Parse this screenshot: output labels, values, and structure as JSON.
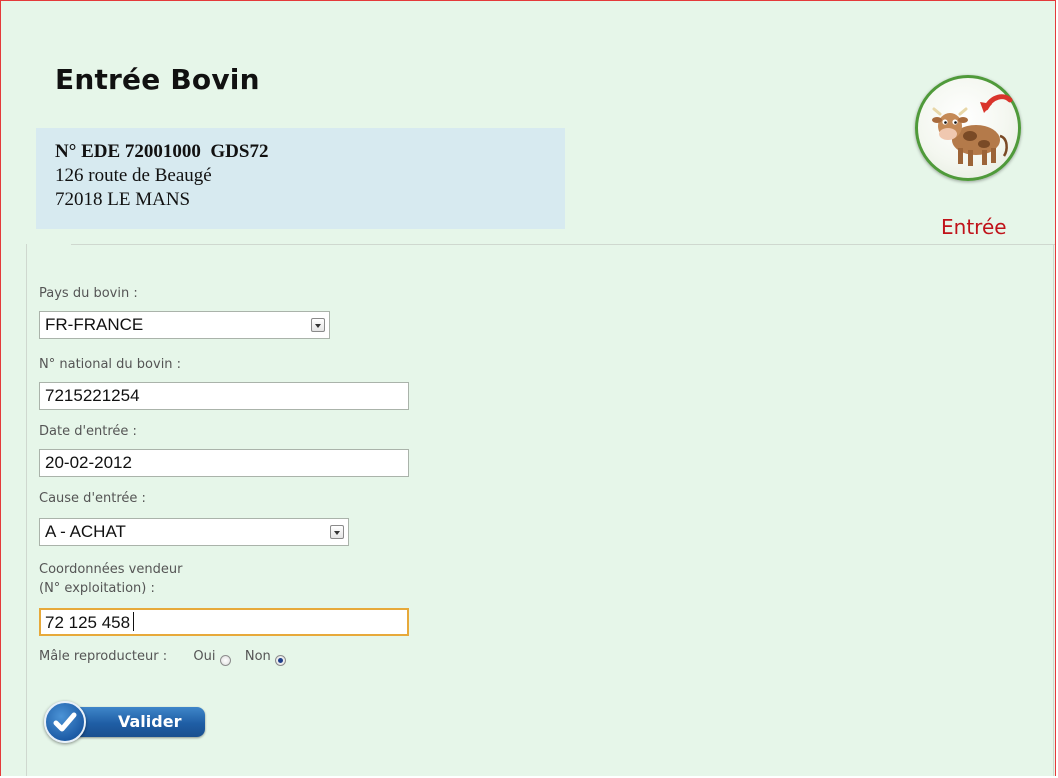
{
  "page": {
    "title": "Entrée Bovin"
  },
  "address": {
    "ede_line": "N° EDE 72001000  GDS72",
    "street": "126 route de Beaugé",
    "city": "72018 LE MANS"
  },
  "logo": {
    "icon": "cow-entry-icon",
    "caption": "Entrée",
    "arrow_color": "#d9342b",
    "ring_color": "#4f9a3a"
  },
  "form": {
    "pays_label": "Pays du bovin :",
    "pays_value": "FR-FRANCE",
    "numero_label": "N° national du bovin :",
    "numero_value": "7215221254",
    "date_label": "Date d'entrée :",
    "date_value": "20-02-2012",
    "cause_label": "Cause d'entrée :",
    "cause_value": "A - ACHAT",
    "vendeur_label_line1": "Coordonnées vendeur",
    "vendeur_label_line2": "(N° exploitation) :",
    "vendeur_value": "72 125 458",
    "male_label": "Mâle reproducteur :",
    "oui_label": "Oui",
    "non_label": "Non",
    "male_selected": "Non"
  },
  "submit": {
    "label": "Valider",
    "icon": "checkmark-icon"
  },
  "colors": {
    "background": "#e6f6e9",
    "address_bg": "#d7eaf0",
    "caption_red": "#c0131a",
    "focus_border": "#e7a93a",
    "button_blue": "#1f5ea5"
  }
}
